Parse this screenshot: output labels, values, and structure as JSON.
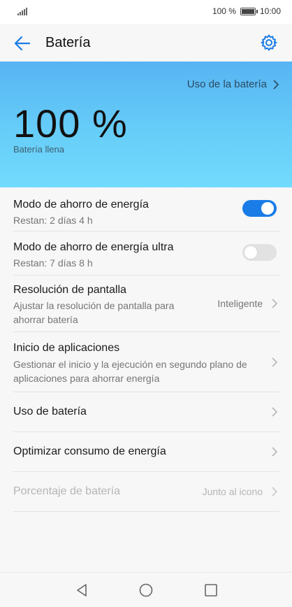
{
  "status": {
    "battery_text": "100 %",
    "time": "10:00"
  },
  "app_bar": {
    "title": "Batería",
    "back_icon": "arrow-left-icon",
    "settings_icon": "gear-icon"
  },
  "hero": {
    "usage_link": "Uso de la batería",
    "percent": "100 %",
    "status": "Batería llena"
  },
  "items": [
    {
      "title": "Modo de ahorro de energía",
      "sub": "Restan: 2 días 4 h",
      "toggle": "on"
    },
    {
      "title": "Modo de ahorro de energía ultra",
      "sub": "Restan: 7 días 8 h",
      "toggle": "off"
    },
    {
      "title": "Resolución de pantalla",
      "sub_line1": "Ajustar la resolución de pantalla para",
      "sub_line2": "ahorrar batería",
      "value": "Inteligente"
    },
    {
      "title": "Inicio de aplicaciones",
      "sub_line1": "Gestionar el inicio y la ejecución en segundo plano de",
      "sub_line2": "aplicaciones para ahorrar energía"
    },
    {
      "title": "Uso de batería"
    },
    {
      "title": "Optimizar consumo de energía"
    },
    {
      "title": "Porcentaje de batería",
      "value": "Junto al icono",
      "disabled": true
    }
  ],
  "colors": {
    "accent": "#1a7ce6",
    "hero_top": "#57b4f3",
    "hero_bottom": "#72dbfc"
  }
}
